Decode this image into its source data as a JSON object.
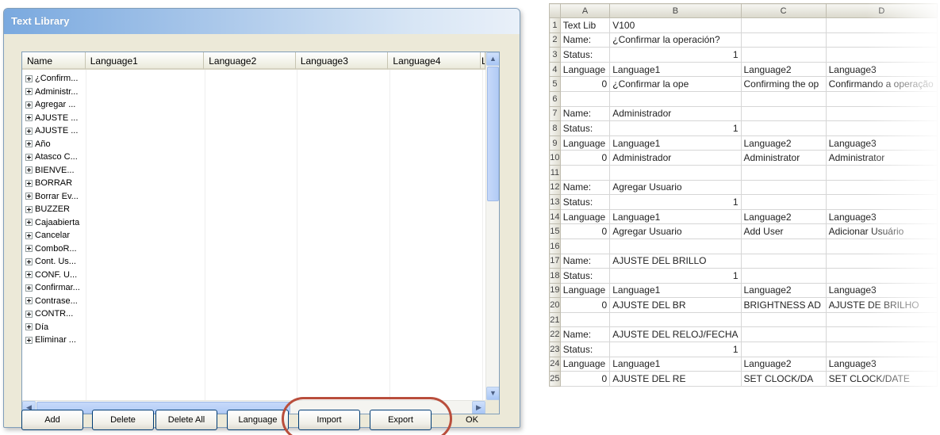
{
  "dialog": {
    "title": "Text Library",
    "columns": [
      "Name",
      "Language1",
      "Language2",
      "Language3",
      "Language4",
      "L"
    ],
    "rows": [
      "¿Confirm...",
      "Administr...",
      "Agregar ...",
      "AJUSTE ...",
      "AJUSTE ...",
      "Año",
      "Atasco C...",
      "BIENVE...",
      "BORRAR",
      "Borrar Ev...",
      "BUZZER",
      "Cajaabierta",
      "Cancelar",
      "ComboR...",
      "Cont. Us...",
      "CONF. U...",
      "Confirmar...",
      "Contrase...",
      "CONTR...",
      "Día",
      "Eliminar ..."
    ],
    "buttons": {
      "add": "Add",
      "delete": "Delete",
      "delete_all": "Delete All",
      "language": "Language",
      "import": "Import",
      "export": "Export",
      "ok": "OK"
    },
    "highlight_color": "#b94e3c"
  },
  "sheet": {
    "columns": [
      "A",
      "B",
      "C",
      "D"
    ],
    "rows": [
      {
        "n": "1",
        "a": "Text Lib",
        "b": "V100",
        "c": "",
        "d": ""
      },
      {
        "n": "2",
        "a": "Name:",
        "b": "¿Confirmar la operación?",
        "c": "",
        "d": ""
      },
      {
        "n": "3",
        "a": "Status:",
        "b": "1",
        "c": "",
        "d": ""
      },
      {
        "n": "4",
        "a": "Language",
        "b": "Language1",
        "c": "Language2",
        "d": "Language3"
      },
      {
        "n": "5",
        "a": "0",
        "b": "¿Confirmar la ope",
        "c": "Confirming the op",
        "d": "Confirmando a operação"
      },
      {
        "n": "6",
        "a": "",
        "b": "",
        "c": "",
        "d": ""
      },
      {
        "n": "7",
        "a": "Name:",
        "b": "Administrador",
        "c": "",
        "d": ""
      },
      {
        "n": "8",
        "a": "Status:",
        "b": "1",
        "c": "",
        "d": ""
      },
      {
        "n": "9",
        "a": "Language",
        "b": "Language1",
        "c": "Language2",
        "d": "Language3"
      },
      {
        "n": "10",
        "a": "0",
        "b": "Administrador",
        "c": "Administrator",
        "d": "Administrator"
      },
      {
        "n": "11",
        "a": "",
        "b": "",
        "c": "",
        "d": ""
      },
      {
        "n": "12",
        "a": "Name:",
        "b": "Agregar Usuario",
        "c": "",
        "d": ""
      },
      {
        "n": "13",
        "a": "Status:",
        "b": "1",
        "c": "",
        "d": ""
      },
      {
        "n": "14",
        "a": "Language",
        "b": "Language1",
        "c": "Language2",
        "d": "Language3"
      },
      {
        "n": "15",
        "a": "0",
        "b": "Agregar Usuario",
        "c": "Add User",
        "d": "Adicionar Usuário"
      },
      {
        "n": "16",
        "a": "",
        "b": "",
        "c": "",
        "d": ""
      },
      {
        "n": "17",
        "a": "Name:",
        "b": "AJUSTE DEL BRILLO",
        "c": "",
        "d": ""
      },
      {
        "n": "18",
        "a": "Status:",
        "b": "1",
        "c": "",
        "d": ""
      },
      {
        "n": "19",
        "a": "Language",
        "b": "Language1",
        "c": "Language2",
        "d": "Language3"
      },
      {
        "n": "20",
        "a": "0",
        "b": "AJUSTE DEL BR",
        "c": "BRIGHTNESS AD",
        "d": "AJUSTE DE BRILHO"
      },
      {
        "n": "21",
        "a": "",
        "b": "",
        "c": "",
        "d": ""
      },
      {
        "n": "22",
        "a": "Name:",
        "b": "AJUSTE DEL RELOJ/FECHA",
        "c": "",
        "d": ""
      },
      {
        "n": "23",
        "a": "Status:",
        "b": "1",
        "c": "",
        "d": ""
      },
      {
        "n": "24",
        "a": "Language",
        "b": "Language1",
        "c": "Language2",
        "d": "Language3"
      },
      {
        "n": "25",
        "a": "0",
        "b": "AJUSTE DEL RE",
        "c": "SET CLOCK/DA",
        "d": "SET CLOCK/DATE"
      }
    ]
  }
}
